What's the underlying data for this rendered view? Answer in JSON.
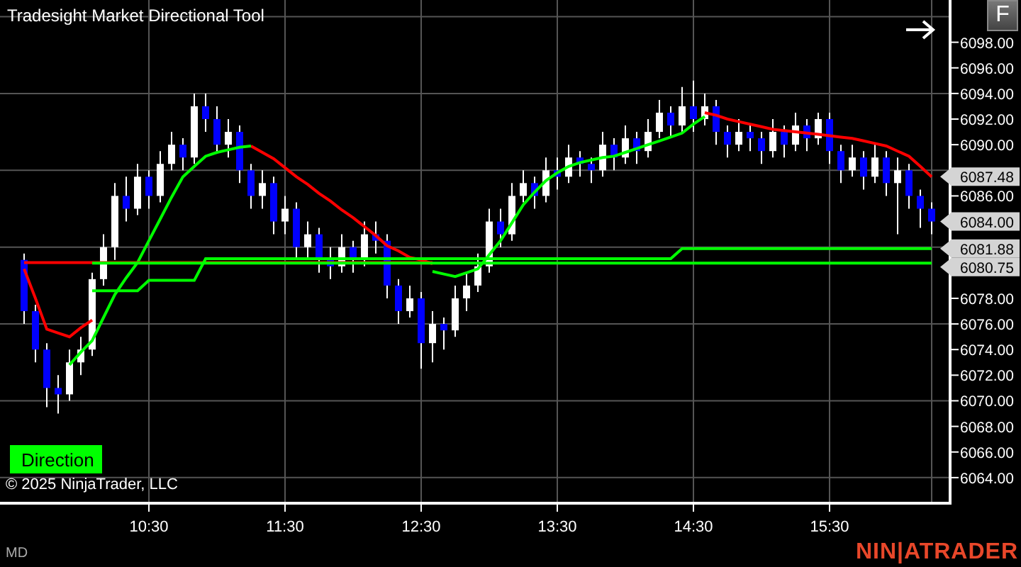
{
  "chart": {
    "chart_data": {
      "type": "candlestick",
      "title": "Tradesight Market Directional Tool",
      "categories": [
        null,
        null,
        null,
        null,
        null,
        null,
        null,
        null,
        null,
        null,
        null,
        "10:30",
        null,
        null,
        null,
        null,
        null,
        null,
        null,
        null,
        null,
        null,
        null,
        "11:30",
        null,
        null,
        null,
        null,
        null,
        null,
        null,
        null,
        null,
        null,
        null,
        "12:30",
        null,
        null,
        null,
        null,
        null,
        null,
        null,
        null,
        null,
        null,
        null,
        "13:30",
        null,
        null,
        null,
        null,
        null,
        null,
        null,
        null,
        null,
        null,
        null,
        "14:30",
        null,
        null,
        null,
        null,
        null,
        null,
        null,
        null,
        null,
        null,
        null,
        "15:30",
        null,
        null,
        null,
        null,
        null,
        null,
        null,
        null,
        null
      ],
      "ylim": [
        6062,
        6101.3
      ],
      "yticks": [
        {
          "value": 6098,
          "label": "6098.00"
        },
        {
          "value": 6096,
          "label": "6096.00"
        },
        {
          "value": 6094,
          "label": "6094.00"
        },
        {
          "value": 6092,
          "label": "6092.00"
        },
        {
          "value": 6090,
          "label": "6090.00"
        },
        {
          "value": 6086,
          "label": "6086.00"
        },
        {
          "value": 6078,
          "label": "6078.00"
        },
        {
          "value": 6076,
          "label": "6076.00"
        },
        {
          "value": 6074,
          "label": "6074.00"
        },
        {
          "value": 6072,
          "label": "6072.00"
        },
        {
          "value": 6070,
          "label": "6070.00"
        },
        {
          "value": 6068,
          "label": "6068.00"
        },
        {
          "value": 6066,
          "label": "6066.00"
        },
        {
          "value": 6064,
          "label": "6064.00"
        }
      ],
      "ohlc": [
        [
          6081,
          6081.5,
          6076,
          6077
        ],
        [
          6077,
          6077.5,
          6073,
          6074
        ],
        [
          6074,
          6074.5,
          6069.5,
          6071
        ],
        [
          6071,
          6072,
          6069,
          6070.5
        ],
        [
          6070.5,
          6074,
          6070,
          6073
        ],
        [
          6073,
          6075,
          6072,
          6074
        ],
        [
          6074,
          6080,
          6073.5,
          6079.5
        ],
        [
          6079.5,
          6083,
          6079,
          6082
        ],
        [
          6082,
          6087,
          6081,
          6086
        ],
        [
          6086,
          6087.5,
          6084,
          6085
        ],
        [
          6085,
          6088.5,
          6084.5,
          6087.5
        ],
        [
          6087.5,
          6088,
          6085,
          6086
        ],
        [
          6086,
          6089.5,
          6085.5,
          6088.5
        ],
        [
          6088.5,
          6091,
          6088,
          6090
        ],
        [
          6090,
          6090.5,
          6088,
          6089
        ],
        [
          6089,
          6094,
          6088.5,
          6093
        ],
        [
          6093,
          6094,
          6091,
          6092
        ],
        [
          6092,
          6093,
          6089.5,
          6090
        ],
        [
          6090,
          6092,
          6089,
          6091
        ],
        [
          6091,
          6091.5,
          6087,
          6088
        ],
        [
          6088,
          6088.5,
          6085,
          6086
        ],
        [
          6086,
          6088,
          6085,
          6087
        ],
        [
          6087,
          6087.5,
          6083,
          6084
        ],
        [
          6084,
          6086,
          6083,
          6085
        ],
        [
          6085,
          6085.5,
          6081,
          6082
        ],
        [
          6082,
          6084,
          6081,
          6083
        ],
        [
          6083,
          6083.5,
          6080,
          6081
        ],
        [
          6081,
          6082,
          6079.5,
          6080.5
        ],
        [
          6080.5,
          6083,
          6080,
          6082
        ],
        [
          6082,
          6082.5,
          6080,
          6081
        ],
        [
          6081,
          6084,
          6080.5,
          6083
        ],
        [
          6083,
          6084,
          6081.5,
          6082.5
        ],
        [
          6082.5,
          6083,
          6078,
          6079
        ],
        [
          6079,
          6079.5,
          6076,
          6077
        ],
        [
          6077,
          6079,
          6076.5,
          6078
        ],
        [
          6078,
          6078.5,
          6072.5,
          6074.5
        ],
        [
          6074.5,
          6077,
          6073,
          6076
        ],
        [
          6076,
          6076.5,
          6074,
          6075.5
        ],
        [
          6075.5,
          6079,
          6075,
          6078
        ],
        [
          6078,
          6080,
          6077,
          6079
        ],
        [
          6079,
          6081.5,
          6078.5,
          6080.5
        ],
        [
          6080.5,
          6085,
          6080,
          6084
        ],
        [
          6084,
          6085,
          6082,
          6083
        ],
        [
          6083,
          6087,
          6082.5,
          6086
        ],
        [
          6086,
          6088,
          6085.5,
          6087
        ],
        [
          6087,
          6087.5,
          6085,
          6086
        ],
        [
          6086,
          6089,
          6085.5,
          6088
        ],
        [
          6088,
          6089,
          6086.5,
          6087.5
        ],
        [
          6087.5,
          6090,
          6087,
          6089
        ],
        [
          6089,
          6089.5,
          6087.5,
          6088.5
        ],
        [
          6088.5,
          6089,
          6087,
          6088
        ],
        [
          6088,
          6091,
          6087.5,
          6090
        ],
        [
          6090,
          6090.5,
          6088,
          6089
        ],
        [
          6089,
          6091.5,
          6088.5,
          6090.5
        ],
        [
          6090.5,
          6091,
          6088.5,
          6089.5
        ],
        [
          6089.5,
          6092,
          6089,
          6091
        ],
        [
          6091,
          6093.5,
          6090.5,
          6092.5
        ],
        [
          6092.5,
          6093,
          6090.5,
          6091.5
        ],
        [
          6091.5,
          6094.5,
          6091,
          6093
        ],
        [
          6093,
          6095,
          6091,
          6092
        ],
        [
          6092,
          6094,
          6091.5,
          6093
        ],
        [
          6093,
          6093.5,
          6090,
          6091
        ],
        [
          6091,
          6091.5,
          6089,
          6090
        ],
        [
          6090,
          6092,
          6089.5,
          6091
        ],
        [
          6091,
          6091.5,
          6089.5,
          6090.5
        ],
        [
          6090.5,
          6091,
          6088.5,
          6089.5
        ],
        [
          6089.5,
          6092,
          6089,
          6091
        ],
        [
          6091,
          6091.5,
          6089,
          6090
        ],
        [
          6090,
          6092.5,
          6089.5,
          6091.5
        ],
        [
          6091.5,
          6092,
          6089.5,
          6090.5
        ],
        [
          6090.5,
          6092.5,
          6090,
          6092
        ],
        [
          6092,
          6092.5,
          6088.5,
          6089.5
        ],
        [
          6089.5,
          6090,
          6087,
          6088
        ],
        [
          6088,
          6090,
          6087.5,
          6089
        ],
        [
          6089,
          6089.5,
          6086.5,
          6087.5
        ],
        [
          6087.5,
          6090,
          6087,
          6089
        ],
        [
          6089,
          6089.5,
          6086,
          6087
        ],
        [
          6087,
          6089,
          6083,
          6088
        ],
        [
          6088,
          6088.5,
          6085,
          6086
        ],
        [
          6086,
          6086.5,
          6083.5,
          6085
        ],
        [
          6085,
          6085.5,
          6083,
          6084
        ]
      ],
      "series": [
        {
          "type": "line",
          "color": "#ff0000",
          "values": [
            6080.3,
            6078.0,
            6075.6,
            6075.3,
            6075.0,
            6075.7,
            6076.3,
            null,
            null,
            null,
            null,
            null,
            null,
            null,
            null,
            null,
            null,
            null,
            null,
            null,
            6089.9,
            6089.4,
            6088.9,
            6088.2,
            6087.5,
            6086.9,
            6086.2,
            6085.6,
            6084.9,
            6084.3,
            6083.6,
            6082.9,
            6082.1,
            6081.7,
            6081.2,
            6081.0,
            6080.7,
            null,
            null,
            null,
            null,
            null,
            null,
            null,
            null,
            null,
            null,
            null,
            null,
            null,
            null,
            null,
            null,
            null,
            null,
            null,
            null,
            null,
            null,
            null,
            6092.5,
            6092.3,
            6092.0,
            6091.8,
            6091.6,
            6091.4,
            6091.2,
            6091.1,
            6091.0,
            6090.9,
            6090.8,
            6090.7,
            6090.6,
            6090.5,
            6090.3,
            6090.1,
            6089.9,
            6089.5,
            6089.1,
            6088.3,
            6087.5
          ]
        },
        {
          "type": "line",
          "color": "#00ff00",
          "values": [
            null,
            null,
            null,
            null,
            6072.8,
            6073.8,
            6074.7,
            6076.5,
            6078.3,
            6079.6,
            6080.8,
            6082.5,
            6084.2,
            6085.9,
            6087.5,
            6088.3,
            6089.1,
            6089.4,
            6089.6,
            6089.8,
            6089.9,
            null,
            null,
            null,
            null,
            null,
            null,
            null,
            null,
            null,
            null,
            null,
            null,
            null,
            null,
            null,
            6080.1,
            6079.9,
            6079.7,
            6080.0,
            6080.3,
            6081.4,
            6082.5,
            6083.9,
            6085.3,
            6086.3,
            6087.2,
            6087.8,
            6088.3,
            6088.6,
            6088.8,
            6089.0,
            6089.1,
            6089.4,
            6089.7,
            6090.0,
            6090.3,
            6090.6,
            6090.9,
            6091.6,
            6092.2,
            null,
            null,
            null,
            null,
            null,
            null,
            null,
            null,
            null,
            null,
            null,
            null,
            null,
            null,
            null,
            null,
            null,
            null,
            null,
            null
          ]
        },
        {
          "type": "line",
          "color": "#ff0000",
          "values": [
            6080.8,
            6080.8,
            6080.8,
            6080.8,
            6080.8,
            6080.8,
            6080.8,
            6080.8,
            6080.8,
            6080.8,
            6080.8,
            6080.8,
            6080.8,
            6080.8,
            6080.8,
            6080.8,
            6080.8,
            6080.8,
            6080.8,
            6080.8,
            6080.8,
            6080.8,
            6080.8,
            6080.8,
            6080.8,
            6080.8,
            6080.8,
            6080.8,
            6080.8,
            6080.8,
            6080.8,
            6080.8,
            6080.8,
            6080.8,
            6080.8,
            6080.8,
            6080.8,
            null,
            null,
            null,
            null,
            null,
            null,
            null,
            null,
            null,
            null,
            null,
            null,
            null,
            null,
            null,
            null,
            null,
            null,
            null,
            null,
            null,
            null,
            null,
            null,
            null,
            null,
            null,
            null,
            null,
            null,
            null,
            null,
            null,
            null,
            null,
            null,
            null,
            null,
            null,
            null,
            null,
            null,
            null,
            null
          ]
        },
        {
          "type": "line",
          "color": "#00ff00",
          "values": [
            null,
            null,
            null,
            null,
            null,
            null,
            6078.6,
            6078.6,
            6078.6,
            6078.6,
            6078.6,
            6079.4,
            6079.4,
            6079.4,
            6079.4,
            6079.4,
            6081.1,
            6081.1,
            6081.1,
            6081.1,
            6081.1,
            6081.1,
            6081.1,
            6081.1,
            6081.1,
            6081.1,
            6081.1,
            6081.1,
            6081.1,
            6081.1,
            6081.1,
            6081.1,
            6081.1,
            6081.1,
            6081.1,
            6081.1,
            6081.1,
            6081.1,
            6081.1,
            6081.1,
            6081.1,
            6081.1,
            6081.1,
            6081.1,
            6081.1,
            6081.1,
            6081.1,
            6081.1,
            6081.1,
            6081.1,
            6081.1,
            6081.1,
            6081.1,
            6081.1,
            6081.1,
            6081.1,
            6081.1,
            6081.1,
            6081.88,
            6081.88,
            6081.88,
            6081.88,
            6081.88,
            6081.88,
            6081.88,
            6081.88,
            6081.88,
            6081.88,
            6081.88,
            6081.88,
            6081.88,
            6081.88,
            6081.88,
            6081.88,
            6081.88,
            6081.88,
            6081.88,
            6081.88,
            6081.88,
            6081.88,
            6081.88
          ]
        },
        {
          "type": "line",
          "color": "#00ff00",
          "values": [
            null,
            null,
            null,
            null,
            null,
            null,
            6080.75,
            6080.75,
            6080.75,
            6080.75,
            6080.75,
            6080.75,
            6080.75,
            6080.75,
            6080.75,
            6080.75,
            6080.75,
            6080.75,
            6080.75,
            6080.75,
            6080.75,
            6080.75,
            6080.75,
            6080.75,
            6080.75,
            6080.75,
            6080.75,
            6080.75,
            6080.75,
            6080.75,
            6080.75,
            6080.75,
            6080.75,
            6080.75,
            6080.75,
            6080.75,
            6080.75,
            6080.75,
            6080.75,
            6080.75,
            6080.75,
            6080.75,
            6080.75,
            6080.75,
            6080.75,
            6080.75,
            6080.75,
            6080.75,
            6080.75,
            6080.75,
            6080.75,
            6080.75,
            6080.75,
            6080.75,
            6080.75,
            6080.75,
            6080.75,
            6080.75,
            6080.75,
            6080.75,
            6080.75,
            6080.75,
            6080.75,
            6080.75,
            6080.75,
            6080.75,
            6080.75,
            6080.75,
            6080.75,
            6080.75,
            6080.75,
            6080.75,
            6080.75,
            6080.75,
            6080.75,
            6080.75,
            6080.75,
            6080.75,
            6080.75,
            6080.75,
            6080.75
          ]
        }
      ],
      "grid": true,
      "annotations": [
        "6087.48",
        "6084.00",
        "6081.88",
        "6080.75"
      ]
    },
    "direction_button": {
      "label": "Direction"
    },
    "copyright": "© 2025 NinjaTrader, LLC",
    "f_button": {
      "label": "F"
    }
  },
  "status": {
    "label": "MD"
  },
  "logo": "NIN|ATRADER"
}
